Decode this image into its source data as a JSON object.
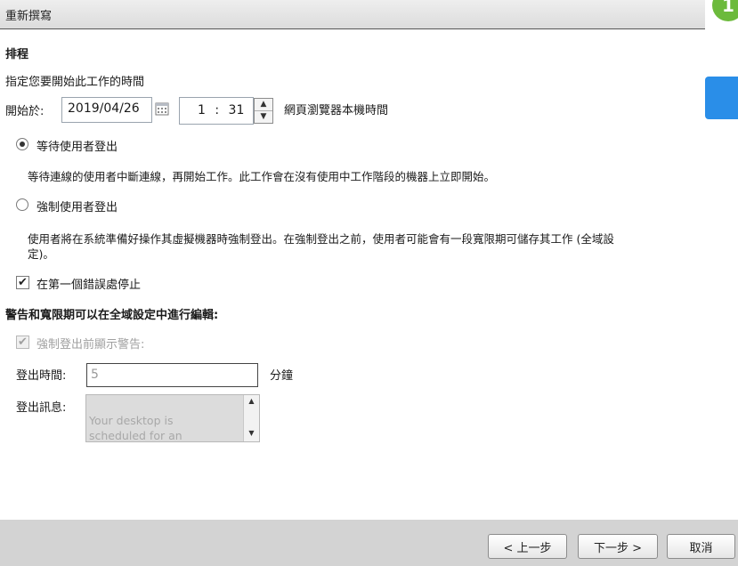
{
  "window": {
    "title": "重新撰寫"
  },
  "schedule": {
    "heading": "排程",
    "instruction": "指定您要開始此工作的時間",
    "start_label": "開始於:",
    "date_value": "2019/04/26",
    "hour": "1",
    "separator": ":",
    "minute": "31",
    "timezone_note": "網頁瀏覽器本機時間"
  },
  "options": {
    "wait_label": "等待使用者登出",
    "wait_desc": "等待連線的使用者中斷連線，再開始工作。此工作會在沒有使用中工作階段的機器上立即開始。",
    "force_label": "強制使用者登出",
    "force_desc_line1": "使用者將在系統準備好操作其虛擬機器時強制登出。在強制登出之前，使用者可能會有一段寬限期可儲存其工作 (全域設",
    "force_desc_line2": "定)。",
    "stop_on_error_label": "在第一個錯誤處停止"
  },
  "warning": {
    "heading": "警告和寬限期可以在全域設定中進行編輯:",
    "show_warning_label": "強制登出前顯示警告:",
    "logout_time_label": "登出時間:",
    "logout_time_value": "5",
    "minutes_unit": "分鐘",
    "logout_message_label": "登出訊息:",
    "logout_message_value": "Your desktop is\nscheduled for an"
  },
  "footer": {
    "prev_label": "< 上一步",
    "next_label": "下一步 >",
    "cancel_label": "取消"
  },
  "badge": {
    "glyph": "1"
  },
  "colors": {
    "accent_blue": "#2a8ee8",
    "badge_green": "#6cba3c",
    "footer_gray": "#d3d3d3"
  }
}
